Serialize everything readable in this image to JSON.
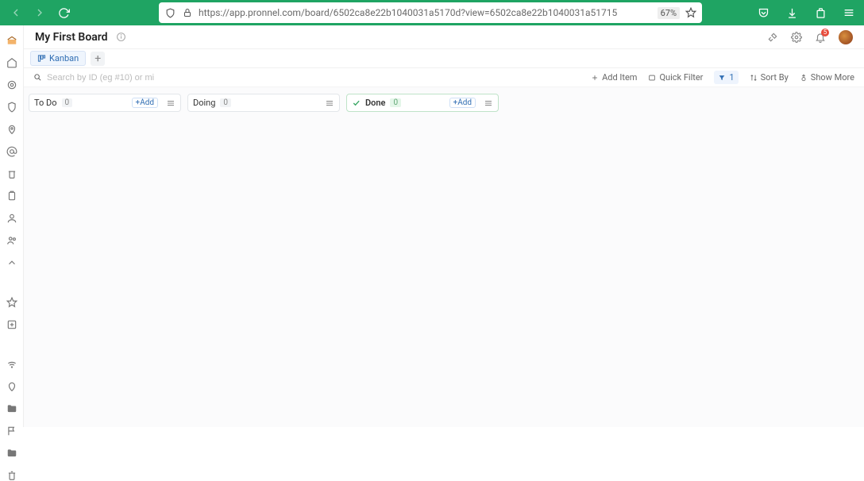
{
  "browser": {
    "url": "https://app.pronnel.com/board/6502ca8e22b1040031a5170d?view=6502ca8e22b1040031a51715",
    "zoom": "67%"
  },
  "header": {
    "title": "My First Board",
    "notif_count": "5"
  },
  "tabs": {
    "kanban": "Kanban"
  },
  "toolbar": {
    "search_placeholder": "Search by ID (eg #10) or mi",
    "add_item": "Add Item",
    "quick_filter": "Quick Filter",
    "filter_count": "1",
    "sort_by": "Sort By",
    "show_more": "Show More"
  },
  "columns": [
    {
      "name": "To Do",
      "count": "0",
      "done": false,
      "show_add": true
    },
    {
      "name": "Doing",
      "count": "0",
      "done": false,
      "show_add": false
    },
    {
      "name": "Done",
      "count": "0",
      "done": true,
      "show_add": true
    }
  ],
  "add_label": "+Add"
}
